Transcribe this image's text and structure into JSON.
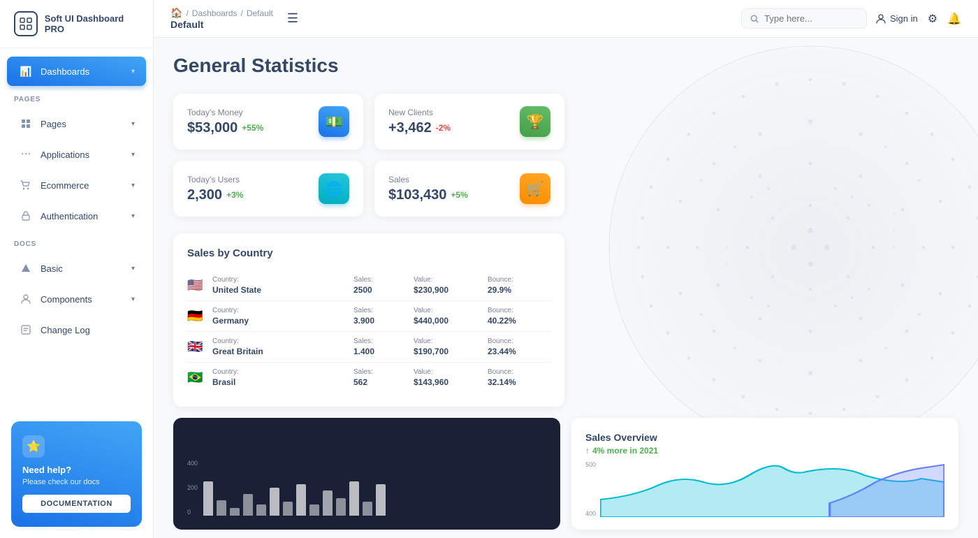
{
  "app": {
    "name": "Soft UI Dashboard PRO"
  },
  "breadcrumb": {
    "home_icon": "🏠",
    "sep1": "/",
    "item1": "Dashboards",
    "sep2": "/",
    "item2": "Default",
    "current": "Default"
  },
  "topbar": {
    "menu_icon": "☰",
    "search_placeholder": "Type here...",
    "signin_label": "Sign in",
    "settings_icon": "⚙",
    "bell_icon": "🔔"
  },
  "page": {
    "title": "General Statistics"
  },
  "stats": [
    {
      "label": "Today's Money",
      "value": "$53,000",
      "change": "+55%",
      "change_type": "pos",
      "icon": "💵",
      "icon_class": ""
    },
    {
      "label": "New Clients",
      "value": "+3,462",
      "change": "-2%",
      "change_type": "neg",
      "icon": "🏆",
      "icon_class": "green"
    },
    {
      "label": "Today's Users",
      "value": "2,300",
      "change": "+3%",
      "change_type": "pos",
      "icon": "🌐",
      "icon_class": "teal"
    },
    {
      "label": "Sales",
      "value": "$103,430",
      "change": "+5%",
      "change_type": "pos",
      "icon": "🛒",
      "icon_class": "orange"
    }
  ],
  "sales_by_country": {
    "title": "Sales by Country",
    "rows": [
      {
        "flag": "🇺🇸",
        "country_label": "Country:",
        "country": "United State",
        "sales_label": "Sales:",
        "sales": "2500",
        "value_label": "Value:",
        "value": "$230,900",
        "bounce_label": "Bounce:",
        "bounce": "29.9%"
      },
      {
        "flag": "🇩🇪",
        "country_label": "Country:",
        "country": "Germany",
        "sales_label": "Sales:",
        "sales": "3.900",
        "value_label": "Value:",
        "value": "$440,000",
        "bounce_label": "Bounce:",
        "bounce": "40.22%"
      },
      {
        "flag": "🇬🇧",
        "country_label": "Country:",
        "country": "Great Britain",
        "sales_label": "Sales:",
        "sales": "1.400",
        "value_label": "Value:",
        "value": "$190,700",
        "bounce_label": "Bounce:",
        "bounce": "23.44%"
      },
      {
        "flag": "🇧🇷",
        "country_label": "Country:",
        "country": "Brasil",
        "sales_label": "Sales:",
        "sales": "562",
        "value_label": "Value:",
        "value": "$143,960",
        "bounce_label": "Bounce:",
        "bounce": "32.14%"
      }
    ]
  },
  "sidebar": {
    "pages_label": "PAGES",
    "docs_label": "DOCS",
    "nav_items": [
      {
        "label": "Dashboards",
        "icon": "📊",
        "active": true
      },
      {
        "label": "Pages",
        "icon": "📄",
        "active": false
      },
      {
        "label": "Applications",
        "icon": "🔧",
        "active": false
      },
      {
        "label": "Ecommerce",
        "icon": "🛍",
        "active": false
      },
      {
        "label": "Authentication",
        "icon": "📋",
        "active": false
      },
      {
        "label": "Basic",
        "icon": "🚀",
        "active": false
      },
      {
        "label": "Components",
        "icon": "👤",
        "active": false
      },
      {
        "label": "Change Log",
        "icon": "📁",
        "active": false
      }
    ],
    "help": {
      "title": "Need help?",
      "subtitle": "Please check our docs",
      "btn_label": "DOCUMENTATION"
    }
  },
  "bottom": {
    "chart_y_labels": [
      "400",
      "200",
      "0"
    ],
    "bar_values": [
      60,
      30,
      15,
      40,
      20,
      50,
      25,
      55,
      20,
      45,
      30,
      60,
      25,
      55
    ],
    "overview_title": "Sales Overview",
    "overview_change": "4% more in 2021",
    "overview_y_labels": [
      "500",
      "400"
    ]
  }
}
